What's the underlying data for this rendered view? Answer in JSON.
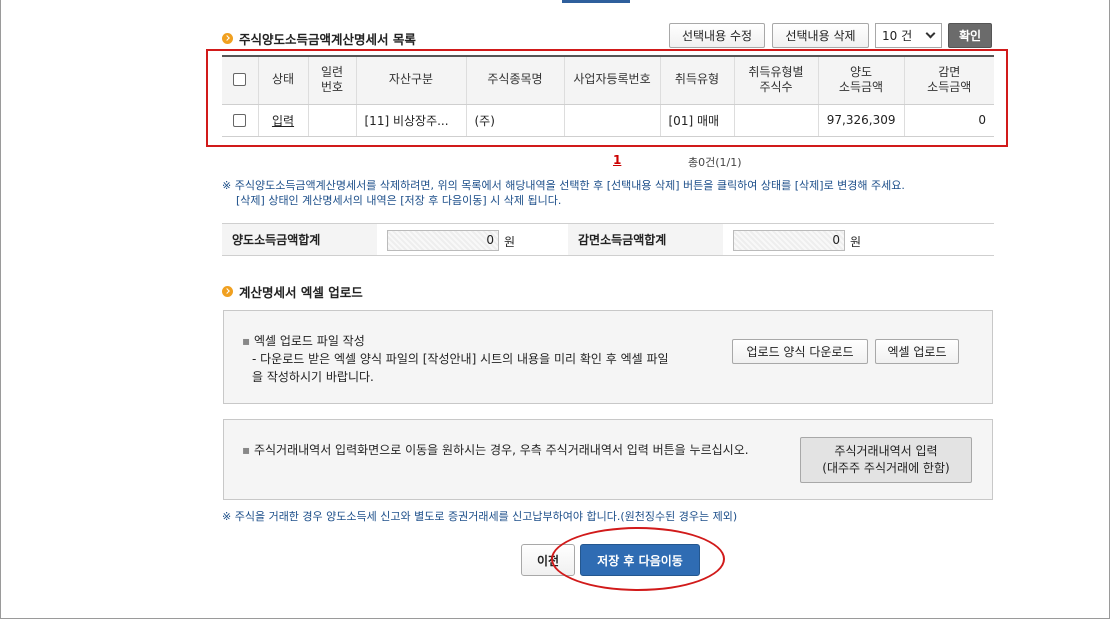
{
  "list_section": {
    "title": "주식양도소득금액계산명세서 목록",
    "edit_button": "선택내용 수정",
    "delete_button": "선택내용 삭제",
    "page_size": "10 건",
    "confirm_button": "확인",
    "columns": [
      "",
      "상태",
      "일련\n번호",
      "자산구분",
      "주식종목명",
      "사업자등록번호",
      "취득유형",
      "취득유형별\n주식수",
      "양도\n소득금액",
      "감면\n소득금액"
    ],
    "rows": [
      {
        "status": "입력",
        "serial": "",
        "asset_type": "[11] 비상장주...",
        "stock_name": "(주)",
        "business_no": "",
        "acquisition_type": "[01] 매매",
        "shares": "",
        "transfer_income": "97,326,309",
        "reduced_income": "0"
      }
    ],
    "pagination": {
      "current_page": "1",
      "total": "총0건(1/1)"
    }
  },
  "notices": {
    "delete_note_line1": "※ 주식양도소득금액계산명세서를 삭제하려면, 위의 목록에서 해당내역을 선택한 후 [선택내용 삭제] 버튼을 클릭하여 상태를 [삭제]로 변경해 주세요.",
    "delete_note_line2": "[삭제] 상태인 계산명세서의 내역은 [저장 후 다음이동] 시 삭제 됩니다.",
    "tax_note": "※ 주식을 거래한 경우 양도소득세 신고와 별도로 증권거래세를 신고납부하여야 합니다.(원천징수된 경우는 제외)"
  },
  "totals": {
    "transfer_label": "양도소득금액합계",
    "transfer_value": "0",
    "reduced_label": "감면소득금액합계",
    "reduced_value": "0",
    "unit": "원"
  },
  "upload_section": {
    "title": "계산명세서 엑셀 업로드",
    "bullet_title": "엑셀 업로드 파일 작성",
    "desc_line1": "- 다운로드 받은 엑셀 양식 파일의 [작성안내] 시트의 내용을 미리 확인 후 엑셀 파일",
    "desc_line2": "을 작성하시기 바랍니다.",
    "download_button": "업로드 양식 다운로드",
    "upload_button": "엑셀 업로드"
  },
  "trade_section": {
    "text": "주식거래내역서 입력화면으로 이동을 원하시는 경우, 우측 주식거래내역서 입력 버튼을 누르십시오.",
    "button_line1": "주식거래내역서 입력",
    "button_line2": "(대주주 주식거래에 한함)"
  },
  "footer": {
    "prev_button": "이전",
    "next_button": "저장 후 다음이동"
  },
  "colors": {
    "accent_blue": "#2f6cb3",
    "highlight_red": "#d11a1a",
    "bullet_orange": "#f0a020"
  }
}
